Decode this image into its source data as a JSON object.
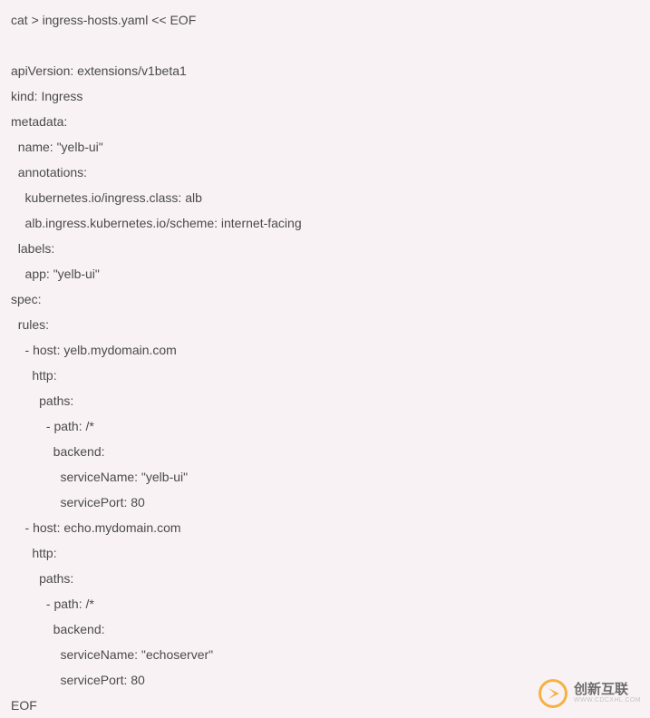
{
  "lines": [
    "cat > ingress-hosts.yaml << EOF",
    "",
    "apiVersion: extensions/v1beta1",
    "kind: Ingress",
    "metadata:",
    "  name: \"yelb-ui\"",
    "  annotations:",
    "    kubernetes.io/ingress.class: alb",
    "    alb.ingress.kubernetes.io/scheme: internet-facing",
    "  labels:",
    "    app: \"yelb-ui\"",
    "spec:",
    "  rules:",
    "    - host: yelb.mydomain.com",
    "      http:",
    "        paths:",
    "          - path: /*",
    "            backend:",
    "              serviceName: \"yelb-ui\"",
    "              servicePort: 80",
    "    - host: echo.mydomain.com",
    "      http:",
    "        paths:",
    "          - path: /*",
    "            backend:",
    "              serviceName: \"echoserver\"",
    "              servicePort: 80",
    "EOF"
  ],
  "watermark": {
    "main": "创新互联",
    "sub": "WWW.CDCXHL.COM"
  }
}
